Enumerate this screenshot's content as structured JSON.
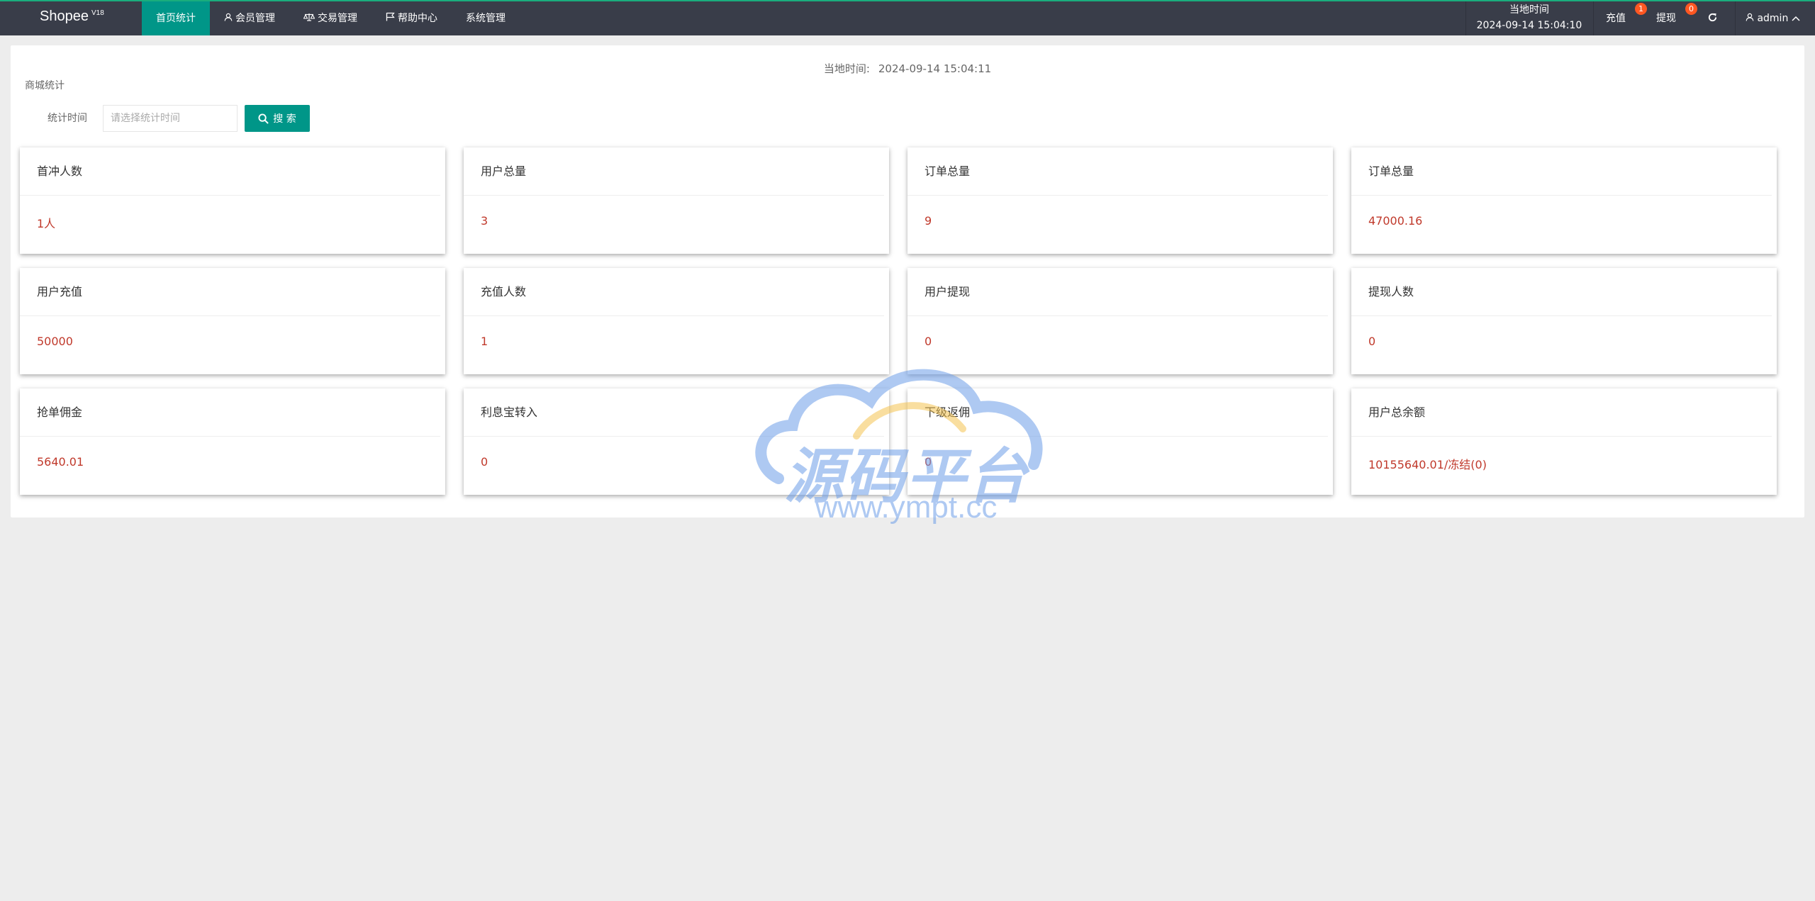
{
  "app": {
    "brand": "Shopee",
    "version": "V18"
  },
  "nav": [
    {
      "label": "首页统计",
      "icon": "",
      "active": true
    },
    {
      "label": "会员管理",
      "icon": "user-icon"
    },
    {
      "label": "交易管理",
      "icon": "scale-icon"
    },
    {
      "label": "帮助中心",
      "icon": "flag-icon"
    },
    {
      "label": "系统管理",
      "icon": ""
    }
  ],
  "header": {
    "local_time_label": "当地时间",
    "local_time_value": "2024-09-14 15:04:10",
    "recharge_label": "充值",
    "recharge_badge": "1",
    "withdraw_label": "提现",
    "withdraw_badge": "0",
    "refresh_icon": "refresh-icon",
    "user_label": "admin"
  },
  "panel": {
    "time_label": "当地时间:",
    "time_value": "2024-09-14 15:04:11",
    "section_title": "商城统计",
    "filter_label": "统计时间",
    "filter_placeholder": "请选择统计时间",
    "search_label": "搜 索"
  },
  "cards": [
    {
      "title": "首冲人数",
      "value": "1人"
    },
    {
      "title": "用户总量",
      "value": "3"
    },
    {
      "title": "订单总量",
      "value": "9"
    },
    {
      "title": "订单总量",
      "value": "47000.16"
    },
    {
      "title": "用户充值",
      "value": "50000"
    },
    {
      "title": "充值人数",
      "value": "1"
    },
    {
      "title": "用户提现",
      "value": "0"
    },
    {
      "title": "提现人数",
      "value": "0"
    },
    {
      "title": "抢单佣金",
      "value": "5640.01"
    },
    {
      "title": "利息宝转入",
      "value": "0"
    },
    {
      "title": "下级返佣",
      "value": "0"
    },
    {
      "title": "用户总余额",
      "value": "10155640.01/冻结(0)"
    }
  ],
  "watermark": {
    "text": "源码平台",
    "url": "www.ympt.cc"
  },
  "colors": {
    "topbar": "#393d49",
    "accent": "#009688",
    "value": "#c0392b",
    "badge": "#ff5722"
  }
}
